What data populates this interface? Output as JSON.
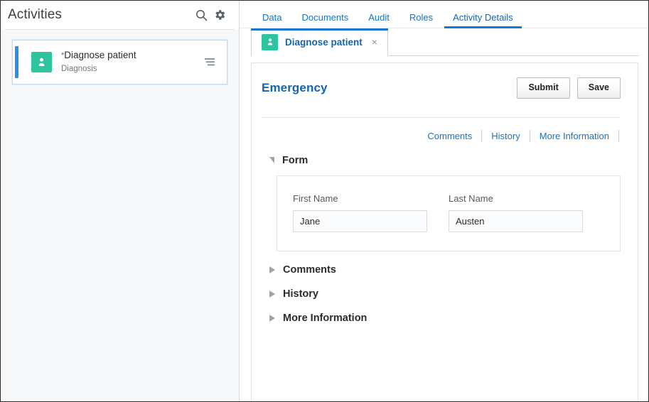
{
  "left_panel": {
    "title": "Activities",
    "search_icon": "search-icon",
    "settings_icon": "gear-icon",
    "activities": [
      {
        "name": "*Diagnose patient",
        "name_star": "*",
        "name_text": "Diagnose patient",
        "subtitle": "Diagnosis",
        "icon": "person-badge-icon",
        "icon_color": "#2fc4a0",
        "accent_color": "#2196e8",
        "menu_icon": "list-menu-icon"
      }
    ]
  },
  "tabs": [
    {
      "label": "Data",
      "active": false
    },
    {
      "label": "Documents",
      "active": false
    },
    {
      "label": "Audit",
      "active": false
    },
    {
      "label": "Roles",
      "active": false
    },
    {
      "label": "Activity Details",
      "active": true
    }
  ],
  "subtab": {
    "label": "Diagnose patient",
    "icon": "person-badge-icon",
    "close_icon": "close-icon",
    "close_glyph": "×"
  },
  "form": {
    "title": "Emergency",
    "buttons": [
      {
        "label": "Submit",
        "name": "submit-button"
      },
      {
        "label": "Save",
        "name": "save-button"
      }
    ],
    "links": [
      {
        "label": "Comments"
      },
      {
        "label": "History"
      },
      {
        "label": "More Information"
      }
    ],
    "sections": [
      {
        "label": "Form",
        "expanded": true
      },
      {
        "label": "Comments",
        "expanded": false
      },
      {
        "label": "History",
        "expanded": false
      },
      {
        "label": "More Information",
        "expanded": false
      }
    ],
    "fields": [
      {
        "label": "First Name",
        "value": "Jane",
        "placeholder": ""
      },
      {
        "label": "Last Name",
        "value": "Austen",
        "placeholder": ""
      }
    ]
  },
  "colors": {
    "accent_blue": "#1976d2",
    "link_blue": "#1b72c0",
    "teal": "#2fc4a0",
    "panel_bg": "#f7f8fa"
  }
}
